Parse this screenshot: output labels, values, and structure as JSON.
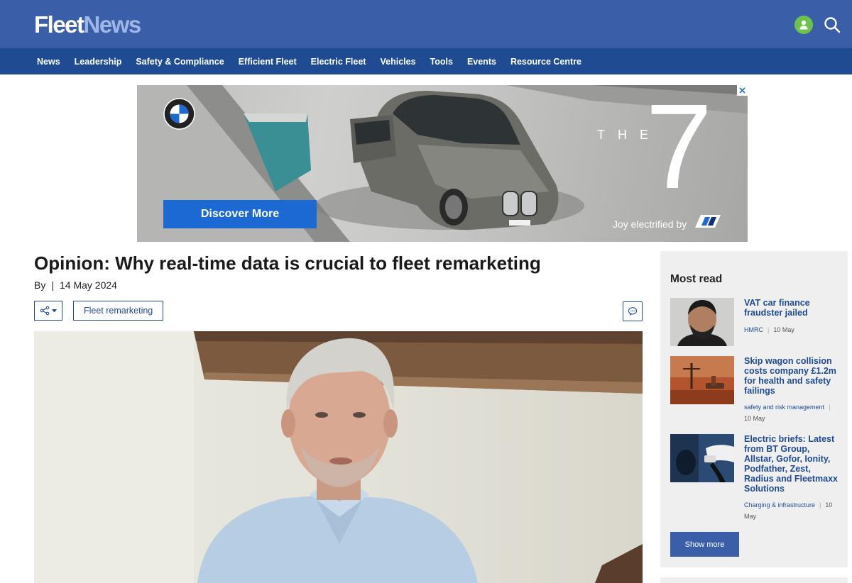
{
  "site": {
    "logo_part1": "Fleet",
    "logo_part2": "News"
  },
  "header": {
    "user_icon": "user-icon",
    "search_icon": "search-icon"
  },
  "nav": {
    "items": [
      {
        "label": "News"
      },
      {
        "label": "Leadership"
      },
      {
        "label": "Safety & Compliance"
      },
      {
        "label": "Efficient Fleet"
      },
      {
        "label": "Electric Fleet"
      },
      {
        "label": "Vehicles"
      },
      {
        "label": "Tools"
      },
      {
        "label": "Events"
      },
      {
        "label": "Resource Centre"
      }
    ]
  },
  "ad": {
    "cta": "Discover More",
    "the": "THE",
    "seven": "7",
    "tagline": "Joy electrified by"
  },
  "article": {
    "headline": "Opinion: Why real-time data is crucial to fleet remarketing",
    "by": "By",
    "date": "14 May 2024",
    "tag": "Fleet remarketing"
  },
  "most_read": {
    "title": "Most read",
    "items": [
      {
        "title": "VAT car finance fraudster jailed",
        "category": "HMRC",
        "date": "10 May"
      },
      {
        "title": "Skip wagon collision costs company £1.2m for health and safety failings",
        "category": "safety and risk management",
        "date": "10 May"
      },
      {
        "title": "Electric briefs: Latest from BT Group, Allstar, Gofor, Ionity, Podfather, Zest, Radius and Fleetmaxx Solutions",
        "category": "Charging & infrastructure",
        "date": "10 May"
      }
    ],
    "show_more": "Show more"
  },
  "colors": {
    "header_bg": "#3a5ea8",
    "nav_bg": "#1f4b93",
    "accent_green": "#6cc24a",
    "link_blue": "#1f4b93",
    "bmw_blue": "#1c69d4"
  }
}
